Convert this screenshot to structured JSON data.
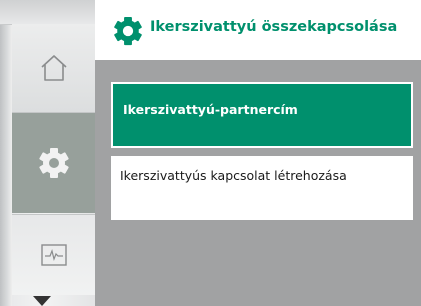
{
  "header": {
    "icon": "gear-icon",
    "title": "Ikerszivattyú összekapcsolása",
    "accent_color": "#00906d"
  },
  "sidebar": {
    "items": [
      {
        "name": "home",
        "icon": "home-icon"
      },
      {
        "name": "settings",
        "icon": "gear-icon",
        "selected": true
      },
      {
        "name": "diagnostics",
        "icon": "pulse-monitor-icon"
      }
    ],
    "scroll_icon": "arrow-down-icon"
  },
  "menu": {
    "items": [
      {
        "label": "Ikerszivattyú-partnercím",
        "selected": true
      },
      {
        "label": "Ikerszivattyús kapcsolat létrehozása",
        "selected": false
      }
    ]
  }
}
